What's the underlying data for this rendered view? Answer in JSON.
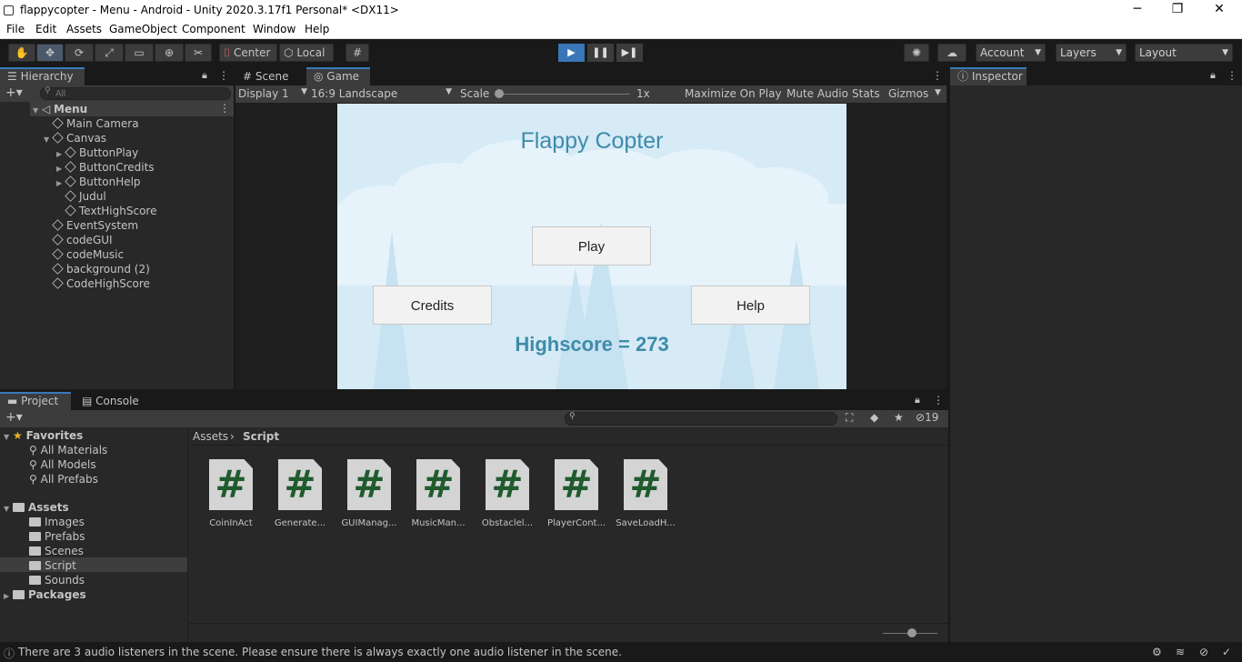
{
  "window": {
    "title": "flappycopter - Menu - Android - Unity 2020.3.17f1 Personal* <DX11>",
    "minimize": "─",
    "maximize": "❐",
    "close": "✕"
  },
  "menu": [
    "File",
    "Edit",
    "Assets",
    "GameObject",
    "Component",
    "Window",
    "Help"
  ],
  "toolbar": {
    "pivot": "Center",
    "space": "Local",
    "account": "Account",
    "layers": "Layers",
    "layout": "Layout",
    "play": "▶",
    "pause": "❚❚",
    "step": "▶❚"
  },
  "hierarchy": {
    "tab": "Hierarchy",
    "search_placeholder": "All",
    "scene": "Menu",
    "items": [
      {
        "label": "Main Camera",
        "level": 1,
        "expand": ""
      },
      {
        "label": "Canvas",
        "level": 1,
        "expand": "▼"
      },
      {
        "label": "ButtonPlay",
        "level": 2,
        "expand": "▶"
      },
      {
        "label": "ButtonCredits",
        "level": 2,
        "expand": "▶"
      },
      {
        "label": "ButtonHelp",
        "level": 2,
        "expand": "▶"
      },
      {
        "label": "Judul",
        "level": 2,
        "expand": ""
      },
      {
        "label": "TextHighScore",
        "level": 2,
        "expand": ""
      },
      {
        "label": "EventSystem",
        "level": 1,
        "expand": ""
      },
      {
        "label": "codeGUI",
        "level": 1,
        "expand": ""
      },
      {
        "label": "codeMusic",
        "level": 1,
        "expand": ""
      },
      {
        "label": "background (2)",
        "level": 1,
        "expand": ""
      },
      {
        "label": "CodeHighScore",
        "level": 1,
        "expand": ""
      }
    ]
  },
  "game_view": {
    "tabs": [
      "Scene",
      "Game"
    ],
    "display": "Display 1",
    "aspect": "16:9 Landscape",
    "scale_label": "Scale",
    "scale_value": "1x",
    "maximize": "Maximize On Play",
    "mute": "Mute Audio",
    "stats": "Stats",
    "gizmos": "Gizmos",
    "game_title": "Flappy Copter",
    "play_button": "Play",
    "credits_button": "Credits",
    "help_button": "Help",
    "highscore": "Highscore = 273"
  },
  "inspector": {
    "tab": "Inspector"
  },
  "project": {
    "tabs": [
      "Project",
      "Console"
    ],
    "hidden_count": "19",
    "favorites_label": "Favorites",
    "favorites": [
      "All Materials",
      "All Models",
      "All Prefabs"
    ],
    "assets_label": "Assets",
    "folders": [
      "Images",
      "Prefabs",
      "Scenes",
      "Script",
      "Sounds"
    ],
    "packages_label": "Packages",
    "breadcrumb": [
      "Assets",
      "Script"
    ],
    "files": [
      "CoinInAct",
      "Generate...",
      "GUIManag...",
      "MusicMan...",
      "Obstaclel...",
      "PlayerCont...",
      "SaveLoadH..."
    ]
  },
  "status": {
    "message": "There are 3 audio listeners in the scene. Please ensure there is always exactly one audio listener in the scene."
  },
  "colors": {
    "accent": "#3a76b8",
    "panel": "#282828",
    "sky": "#d9edf7",
    "highscore": "#3f8bab",
    "title": "#3f8bab"
  }
}
